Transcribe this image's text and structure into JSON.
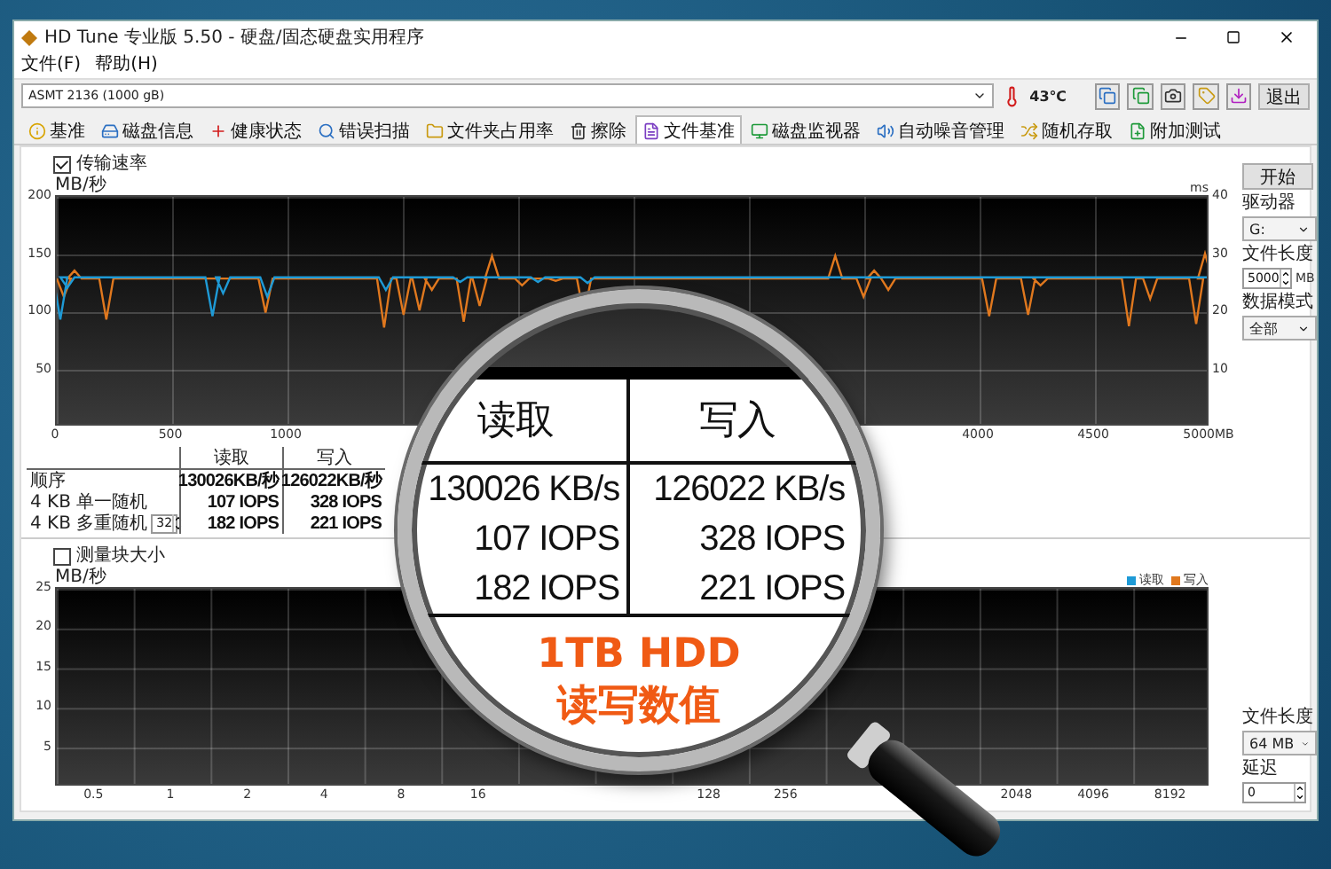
{
  "window": {
    "title": "HD Tune 专业版 5.50 - 硬盘/固态硬盘实用程序"
  },
  "menu": [
    "文件(F)",
    "帮助(H)"
  ],
  "drive": {
    "name": "ASMT   2136 (1000 gB)",
    "temperature": "43℃"
  },
  "exit_button": "退出",
  "tabs": [
    {
      "label": "基准",
      "selected": false
    },
    {
      "label": "磁盘信息",
      "selected": false
    },
    {
      "label": "健康状态",
      "selected": false
    },
    {
      "label": "错误扫描",
      "selected": false
    },
    {
      "label": "文件夹占用率",
      "selected": false
    },
    {
      "label": "擦除",
      "selected": false
    },
    {
      "label": "文件基准",
      "selected": true
    },
    {
      "label": "磁盘监视器",
      "selected": false
    },
    {
      "label": "自动噪音管理",
      "selected": false
    },
    {
      "label": "随机存取",
      "selected": false
    },
    {
      "label": "附加测试",
      "selected": false
    }
  ],
  "transfer": {
    "checkbox": {
      "label": "传输速率",
      "checked": true
    },
    "y_unit": "MB/秒",
    "y_labels": [
      "200",
      "150",
      "100",
      "50"
    ],
    "y2_unit": "ms",
    "y2_labels": [
      "40",
      "30",
      "20",
      "10"
    ],
    "x_labels": [
      "0",
      "500",
      "1000",
      "4000",
      "4500",
      "5000MB"
    ],
    "columns": [
      "读取",
      "写入"
    ],
    "rows": [
      {
        "label": "顺序",
        "read": "130026KB/秒",
        "write": "126022KB/秒"
      },
      {
        "label": "4 KB 单一随机",
        "read": "107 IOPS",
        "write": "328 IOPS"
      },
      {
        "label": "4 KB 多重随机",
        "queue": "32",
        "read": "182 IOPS",
        "write": "221 IOPS"
      }
    ]
  },
  "transfer_settings": {
    "start_button": "开始",
    "drive_label": "驱动器",
    "drive_value": "G:",
    "file_length_label": "文件长度",
    "file_length_value": "5000",
    "file_length_unit": "MB",
    "data_mode_label": "数据模式",
    "data_mode_value": "全部"
  },
  "block": {
    "checkbox": {
      "label": "测量块大小",
      "checked": false
    },
    "y_unit": "MB/秒",
    "y_labels": [
      "25",
      "20",
      "15",
      "10",
      "5"
    ],
    "x_labels": [
      "0.5",
      "1",
      "2",
      "4",
      "8",
      "16",
      "128",
      "256",
      "2048",
      "4096",
      "8192"
    ],
    "legend": [
      {
        "label": "读取",
        "color": "#1e9ad6"
      },
      {
        "label": "写入",
        "color": "#e0781e"
      }
    ]
  },
  "block_settings": {
    "file_length_label": "文件长度",
    "file_length_value": "64 MB",
    "delay_label": "延迟",
    "delay_value": "0"
  },
  "magnifier": {
    "columns": [
      "读取",
      "写入"
    ],
    "rows": [
      {
        "read": "130026 KB/s",
        "write": "126022 KB/s"
      },
      {
        "read": "107 IOPS",
        "write": "328 IOPS"
      },
      {
        "read": "182 IOPS",
        "write": "221 IOPS"
      }
    ],
    "caption": [
      "1TB HDD",
      "读写数值"
    ]
  }
}
